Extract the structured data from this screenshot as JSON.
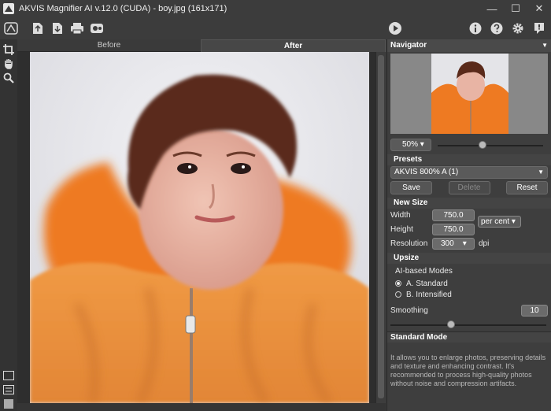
{
  "window": {
    "title": "AKVIS Magnifier AI v.12.0 (CUDA) - boy.jpg (161x171)",
    "minimize": "—",
    "maximize": "☐",
    "close": "✕"
  },
  "tabs": {
    "before": "Before",
    "after": "After"
  },
  "navigator": {
    "title": "Navigator",
    "zoom": "50%",
    "zoom_fraction": 0.5
  },
  "presets": {
    "title": "Presets",
    "selected": "AKVIS 800% A (1)",
    "save": "Save",
    "delete": "Delete",
    "reset": "Reset"
  },
  "new_size": {
    "title": "New Size",
    "width_label": "Width",
    "width": "750.0",
    "height_label": "Height",
    "height": "750.0",
    "units": "per cent",
    "resolution_label": "Resolution",
    "resolution": "300",
    "resolution_unit": "dpi"
  },
  "upsize": {
    "title": "Upsize",
    "subtitle": "AI-based Modes",
    "mode_a": "A. Standard",
    "mode_b": "B. Intensified",
    "smoothing_label": "Smoothing",
    "smoothing": "10"
  },
  "mode_info": {
    "title": "Standard Mode",
    "description": "It allows you to enlarge photos, preserving details and texture and enhancing contrast. It's recommended to process high-quality photos without noise and compression artifacts."
  },
  "colors": {
    "panel": "#3e3e3e",
    "canvas": "#2e2e2e",
    "coat": "#e8873a"
  }
}
